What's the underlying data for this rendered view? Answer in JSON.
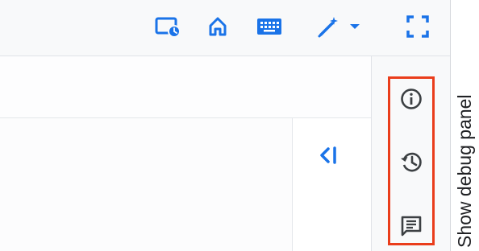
{
  "toolbar": {
    "icons": [
      "screen-schedule-icon",
      "home-icon",
      "keyboard-icon",
      "magic-pen-icon",
      "chevron-down-icon",
      "fullscreen-icon"
    ],
    "accent_color": "#1a73e8"
  },
  "main": {
    "collapse_icon": "collapse-left-icon"
  },
  "side_panel": {
    "icons": [
      "info-icon",
      "history-icon",
      "comment-icon"
    ],
    "highlight_color": "#ea3d1b"
  },
  "debug_tab": {
    "label": "Show debug panel"
  }
}
